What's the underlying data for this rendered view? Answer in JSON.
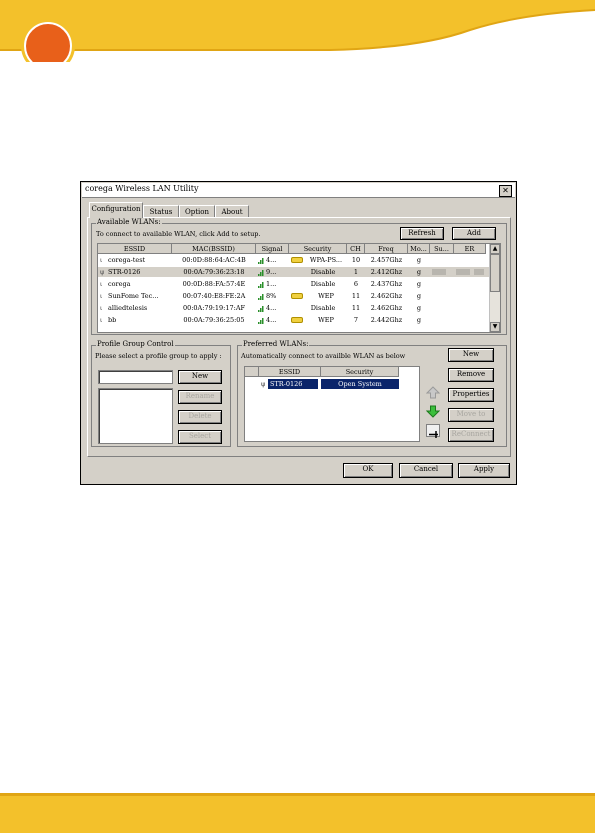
{
  "window": {
    "title": "corega Wireless LAN Utility",
    "close": "✕"
  },
  "tabs": [
    "Configuration",
    "Status",
    "Option",
    "About"
  ],
  "available": {
    "caption": "Available WLANs:",
    "hint": "To connect to available WLAN, click Add to setup.",
    "refresh": "Refresh",
    "add": "Add",
    "columns": [
      "ESSID",
      "MAC(BSSID)",
      "Signal",
      "Security",
      "CH",
      "Freq",
      "Mo...",
      "Su...",
      "ER"
    ],
    "rows": [
      {
        "essid": "corega-test",
        "mac": "00:0D:88:64:AC:4B",
        "signal": "4...",
        "key": true,
        "security": "WPA-PS...",
        "ch": "10",
        "freq": "2.457Ghz",
        "mode": "g",
        "selected": false
      },
      {
        "essid": "STR-0126",
        "mac": "00:0A:79:36:23:18",
        "signal": "9...",
        "key": false,
        "security": "Disable",
        "ch": "1",
        "freq": "2.412Ghz",
        "mode": "g",
        "selected": true
      },
      {
        "essid": "corega",
        "mac": "00:0D:88:FA:57:4E",
        "signal": "1...",
        "key": false,
        "security": "Disable",
        "ch": "6",
        "freq": "2.437Ghz",
        "mode": "g",
        "selected": false
      },
      {
        "essid": "SunFome Tec...",
        "mac": "00:07:40:E8:FE:2A",
        "signal": "8%",
        "key": true,
        "security": "WEP",
        "ch": "11",
        "freq": "2.462Ghz",
        "mode": "g",
        "selected": false
      },
      {
        "essid": "alliedtelesis",
        "mac": "00:0A:79:19:17:AF",
        "signal": "4...",
        "key": false,
        "security": "Disable",
        "ch": "11",
        "freq": "2.462Ghz",
        "mode": "g",
        "selected": false
      },
      {
        "essid": "bb",
        "mac": "00:0A:79:36:25:05",
        "signal": "4...",
        "key": true,
        "security": "WEP",
        "ch": "7",
        "freq": "2.442Ghz",
        "mode": "g",
        "selected": false
      }
    ]
  },
  "profile": {
    "caption": "Profile Group Control",
    "hint": "Please select a profile group to apply :",
    "buttons": [
      "New",
      "Rename",
      "Delete",
      "Select"
    ]
  },
  "preferred": {
    "caption": "Preferred WLANs:",
    "hint": "Automatically connect to availble WLAN as below",
    "columns": [
      "ESSID",
      "Security"
    ],
    "rows": [
      {
        "essid": "STR-0126",
        "security": "Open System"
      }
    ],
    "buttons": [
      "New",
      "Remove",
      "Properties",
      "Move to",
      "ReConnect"
    ]
  },
  "footer": {
    "ok": "OK",
    "cancel": "Cancel",
    "apply": "Apply"
  }
}
